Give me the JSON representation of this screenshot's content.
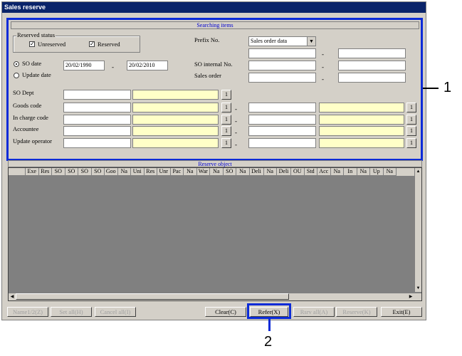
{
  "window": {
    "title": "Sales reserve"
  },
  "search": {
    "section_title": "Searching items",
    "reserved_status": {
      "legend": "Reserved status",
      "unreserved_label": "Unreserved",
      "unreserved_checked": true,
      "reserved_label": "Reserved",
      "reserved_checked": true
    },
    "date_mode": {
      "so_date_label": "SO date",
      "update_date_label": "Update date",
      "selected": "SO date"
    },
    "date_from": "20/02/1990",
    "date_to": "20/02/2010",
    "prefix_label": "Prefix No.",
    "prefix_value": "Sales order data",
    "so_internal_label": "SO internal No.",
    "sales_order_label": "Sales order",
    "rows": [
      {
        "label": "SO Dept"
      },
      {
        "label": "Goods code"
      },
      {
        "label": "In charge code"
      },
      {
        "label": "Accountee"
      },
      {
        "label": "Update operator"
      }
    ],
    "lookup_label": "1",
    "dash": "-"
  },
  "reserve": {
    "section_title": "Reserve object",
    "columns": [
      "Exe",
      "Res",
      "SO",
      "SO",
      "SO",
      "SO",
      "Goo",
      "Na",
      "Uni",
      "Res",
      "Unr",
      "Pac",
      "Na",
      "War",
      "Na",
      "SO",
      "Na",
      "Deli",
      "Na",
      "Deli",
      "OU",
      "Std",
      "Acc",
      "Na",
      "In",
      "Na",
      "Up",
      "Na"
    ]
  },
  "buttons": {
    "name": "Name1/2(Z)",
    "set_all": "Set all(H)",
    "cancel_all": "Cancel all(I)",
    "clear": "Clear(C)",
    "refer": "Refer(X)",
    "rsrv_all": "Rsrv all(A)",
    "reserve": "Reserve(K)",
    "exit": "Exit(E)"
  },
  "callouts": {
    "one": "1",
    "two": "2"
  },
  "colors": {
    "highlight": "#0b2bd8",
    "title_bar": "#0a246a",
    "yellow_field": "#ffffc8"
  }
}
